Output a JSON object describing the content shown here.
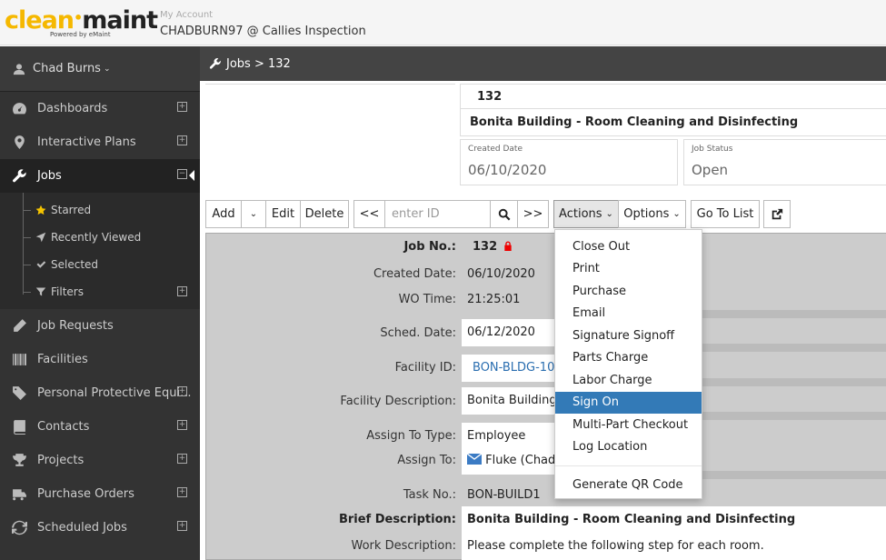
{
  "header": {
    "logo_part1": "clean",
    "logo_part2": "maint",
    "logo_sub": "Powered by eMaint",
    "account_label": "My Account",
    "account_name": "CHADBURN97 @ Callies Inspection"
  },
  "sidebar": {
    "user_name": "Chad Burns",
    "items": [
      {
        "label": "Dashboards",
        "icon": "dashboard-icon"
      },
      {
        "label": "Interactive Plans",
        "icon": "map-marker-icon"
      },
      {
        "label": "Jobs",
        "icon": "wrench-icon"
      },
      {
        "label": "Job Requests",
        "icon": "pencil-icon"
      },
      {
        "label": "Facilities",
        "icon": "barcode-icon"
      },
      {
        "label": "Personal Protective Equi...",
        "icon": "tag-icon"
      },
      {
        "label": "Contacts",
        "icon": "book-icon"
      },
      {
        "label": "Projects",
        "icon": "trophy-icon"
      },
      {
        "label": "Purchase Orders",
        "icon": "truck-icon"
      },
      {
        "label": "Scheduled Jobs",
        "icon": "refresh-icon"
      }
    ],
    "sub_items": [
      {
        "label": "Starred",
        "icon": "star-icon"
      },
      {
        "label": "Recently Viewed",
        "icon": "location-arrow-icon"
      },
      {
        "label": "Selected",
        "icon": "check-icon"
      },
      {
        "label": "Filters",
        "icon": "filter-icon"
      }
    ]
  },
  "breadcrumb": "Jobs > 132",
  "job_header": {
    "number": "132",
    "description": "Bonita Building - Room Cleaning and Disinfecting",
    "created_label": "Created Date",
    "created_value": "06/10/2020",
    "status_label": "Job Status",
    "status_value": "Open"
  },
  "toolbar": {
    "add": "Add",
    "edit": "Edit",
    "delete": "Delete",
    "prev": "<<",
    "id_placeholder": "enter ID",
    "next": ">>",
    "actions": "Actions",
    "options": "Options",
    "go_to_list": "Go To List"
  },
  "details": {
    "job_no_label": "Job No.:",
    "job_no_value": "132",
    "created_label": "Created Date:",
    "created_value": "06/10/2020",
    "wo_time_label": "WO Time:",
    "wo_time_value": "21:25:01",
    "sched_label": "Sched. Date:",
    "sched_value": "06/12/2020",
    "facility_id_label": "Facility ID:",
    "facility_id_value": "BON-BLDG-100",
    "facility_desc_label": "Facility Description:",
    "facility_desc_value": "Bonita Building 1",
    "assign_type_label": "Assign To Type:",
    "assign_type_value": "Employee",
    "assign_to_label": "Assign To:",
    "assign_to_value": "Fluke (Chad B",
    "task_label": "Task No.:",
    "task_value": "BON-BUILD1",
    "brief_label": "Brief Description:",
    "brief_value": "Bonita Building - Room Cleaning and Disinfecting",
    "work_label": "Work Description:",
    "work_value": "Please complete the following step for each room."
  },
  "actions_menu": {
    "items": [
      "Close Out",
      "Print",
      "Purchase",
      "Email",
      "Signature Signoff",
      "Parts Charge",
      "Labor Charge",
      "Sign On",
      "Multi-Part Checkout",
      "Log Location"
    ],
    "active": "Sign On",
    "extra": "Generate QR Code"
  },
  "colors": {
    "logo_yellow": "#f5b800",
    "sidebar_bg": "#333333",
    "menu_highlight": "#337ab7",
    "link_blue": "#2a6eb0"
  }
}
